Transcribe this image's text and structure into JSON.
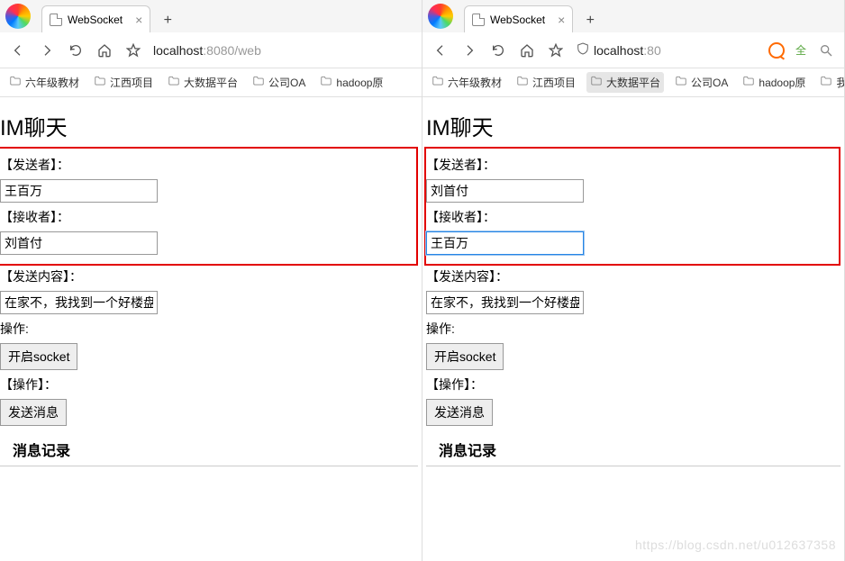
{
  "left": {
    "tab_title": "WebSocket",
    "url_host": "localhost",
    "url_rest": ":8080/web",
    "bookmarks": [
      {
        "label": "六年级教材"
      },
      {
        "label": "江西项目"
      },
      {
        "label": "大数据平台"
      },
      {
        "label": "公司OA"
      },
      {
        "label": "hadoop原"
      }
    ],
    "page": {
      "title": "IM聊天",
      "sender_label": "【发送者】：",
      "sender_value": "王百万",
      "receiver_label": "【接收者】：",
      "receiver_value": "刘首付",
      "content_label": "【发送内容】：",
      "content_value": "在家不，我找到一个好楼盘",
      "op_label": "操作:",
      "open_socket_btn": "开启socket",
      "action_label": "【操作】：",
      "send_btn": "发送消息",
      "log_heading": "消息记录"
    }
  },
  "right": {
    "tab_title": "WebSocket",
    "url_host": "localhost",
    "url_rest": ":80",
    "q_label": "全",
    "bookmarks": [
      {
        "label": "六年级教材"
      },
      {
        "label": "江西项目"
      },
      {
        "label": "大数据平台",
        "active": true
      },
      {
        "label": "公司OA"
      },
      {
        "label": "hadoop原"
      },
      {
        "label": "我的书签"
      }
    ],
    "page": {
      "title": "IM聊天",
      "sender_label": "【发送者】：",
      "sender_value": "刘首付",
      "receiver_label": "【接收者】：",
      "receiver_value": "王百万",
      "content_label": "【发送内容】：",
      "content_value": "在家不，我找到一个好楼盘",
      "op_label": "操作:",
      "open_socket_btn": "开启socket",
      "action_label": "【操作】：",
      "send_btn": "发送消息",
      "log_heading": "消息记录"
    }
  },
  "watermark": "https://blog.csdn.net/u012637358"
}
